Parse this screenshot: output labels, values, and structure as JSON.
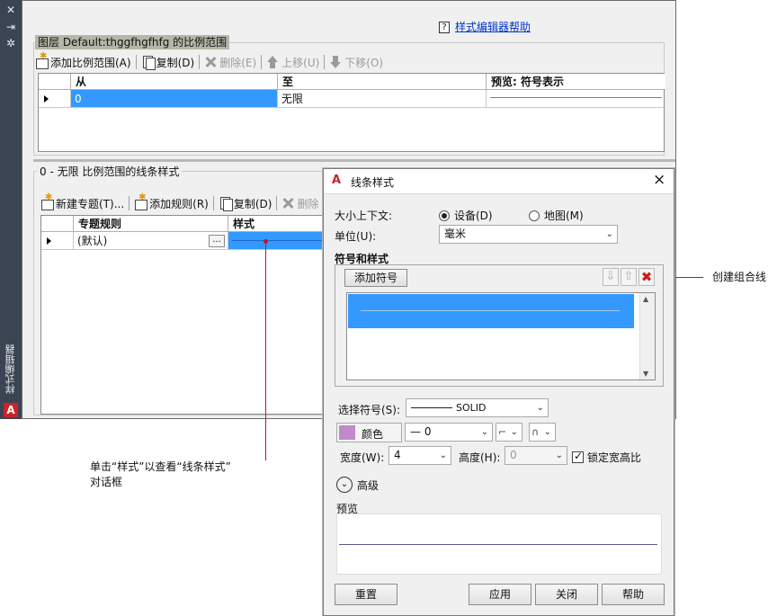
{
  "palette": {
    "vertical_label": "样式编辑器",
    "logo": "A"
  },
  "editor": {
    "help_link": "样式编辑器帮助",
    "scale_range_group": "图层 Default:thggfhgfhfg 的比例范围",
    "toolbar1": {
      "add_range": "添加比例范围(A)",
      "copy": "复制(D)",
      "delete": "删除(E)",
      "move_up": "上移(U)",
      "move_down": "下移(O)"
    },
    "range_grid": {
      "headers": [
        "从",
        "至",
        "预览: 符号表示"
      ],
      "rows": [
        {
          "from": "0",
          "to": "无限"
        }
      ]
    },
    "line_style_group": "0 - 无限 比例范围的线条样式",
    "toolbar2": {
      "new_theme": "新建专题(T)...",
      "add_rule": "添加规则(R)",
      "copy": "复制(D)",
      "delete": "删除"
    },
    "rule_grid": {
      "headers": [
        "专题规则",
        "样式"
      ],
      "rows": [
        {
          "rule": "(默认)",
          "ellipsis": "..."
        }
      ]
    }
  },
  "dialog": {
    "title": "线条样式",
    "close": "×",
    "size_context_label": "大小上下文:",
    "device_option": "设备(D)",
    "map_option": "地图(M)",
    "size_context": "device",
    "units_label": "单位(U):",
    "units_value": "毫米",
    "symbols_section": "符号和样式",
    "add_symbol": "添加符号",
    "select_symbol_label": "选择符号(S):",
    "symbol_value": "SOLID",
    "color_label": "颜色",
    "color_value": "#c08ac8",
    "line_weight_value": "— 0",
    "width_label": "宽度(W):",
    "width_value": "4",
    "height_label": "高度(H):",
    "height_value": "0",
    "lock_ratio_label": "锁定宽高比",
    "lock_ratio_checked": true,
    "advanced_label": "高级",
    "preview_label": "预览",
    "reset": "重置",
    "apply": "应用",
    "close_button": "关闭",
    "help": "帮助"
  },
  "annotations": {
    "create_compound_line": "创建组合线",
    "click_style_line1": "单击“样式”以查看“线条样式”",
    "click_style_line2": "对话框"
  },
  "colors": {
    "selection": "#3399ff",
    "callout_line": "#c8102e",
    "palette_bg": "#3b4453"
  }
}
